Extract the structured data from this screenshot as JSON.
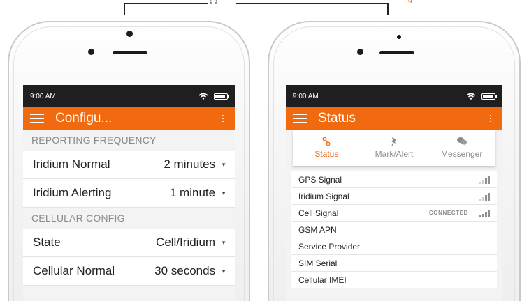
{
  "theme": {
    "accent": "#f26a0f",
    "statusbar_bg": "#1f1f1f",
    "screen_bg": "#f3f3f3"
  },
  "left_phone": {
    "time": "9:00 AM",
    "app_title": "Configu...",
    "sections": [
      {
        "header": "REPORTING FREQUENCY",
        "rows": [
          {
            "label": "Iridium Normal",
            "value": "2 minutes"
          },
          {
            "label": "Iridium Alerting",
            "value": "1 minute"
          }
        ]
      },
      {
        "header": "CELLULAR CONFIG",
        "rows": [
          {
            "label": "State",
            "value": "Cell/Iridium"
          },
          {
            "label": "Cellular Normal",
            "value": "30 seconds"
          }
        ]
      }
    ]
  },
  "right_phone": {
    "time": "9:00 AM",
    "app_title": "Status",
    "tabs": [
      {
        "label": "Status",
        "icon": "satellite-icon",
        "active": true
      },
      {
        "label": "Mark/Alert",
        "icon": "pin-icon",
        "active": false
      },
      {
        "label": "Messenger",
        "icon": "chat-bubbles-icon",
        "active": false
      }
    ],
    "status_items": [
      {
        "label": "GPS Signal",
        "status_text": "",
        "signal_level": 2
      },
      {
        "label": "Iridium Signal",
        "status_text": "",
        "signal_level": 2
      },
      {
        "label": "Cell Signal",
        "status_text": "CONNECTED",
        "signal_level": 4
      },
      {
        "label": "GSM APN",
        "status_text": "",
        "signal_level": null
      },
      {
        "label": "Service Provider",
        "status_text": "",
        "signal_level": null
      },
      {
        "label": "SIM Serial",
        "status_text": "",
        "signal_level": null
      },
      {
        "label": "Cellular IMEI",
        "status_text": "",
        "signal_level": null
      }
    ]
  }
}
